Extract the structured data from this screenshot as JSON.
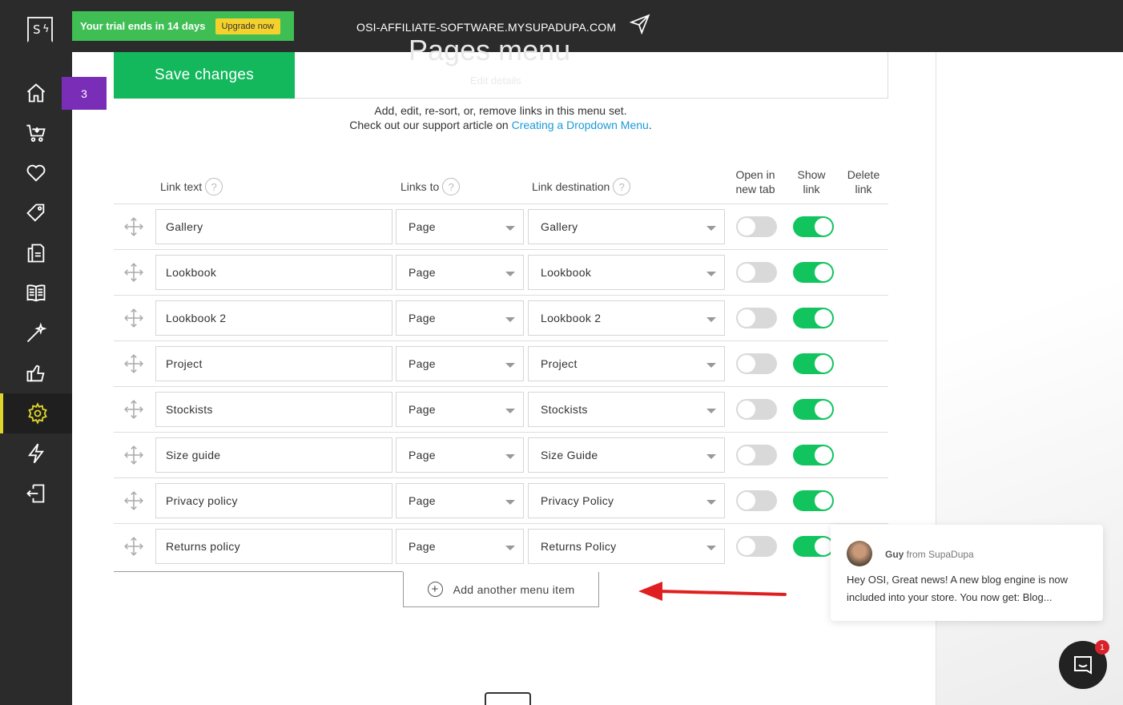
{
  "topbar": {
    "trial_text": "Your trial ends in 14 days",
    "upgrade_label": "Upgrade now",
    "site_url": "OSI-AFFILIATE-SOFTWARE.MYSUPADUPA.COM"
  },
  "sidebar": {
    "logo": "S",
    "badge_count": "3",
    "items": [
      {
        "icon": "home-icon"
      },
      {
        "icon": "cart-icon"
      },
      {
        "icon": "heart-icon"
      },
      {
        "icon": "tag-icon"
      },
      {
        "icon": "pages-icon"
      },
      {
        "icon": "book-icon"
      },
      {
        "icon": "magic-wand-icon"
      },
      {
        "icon": "thumbs-up-icon"
      },
      {
        "icon": "gear-icon",
        "active": true
      },
      {
        "icon": "lightning-icon"
      },
      {
        "icon": "logout-icon"
      }
    ]
  },
  "page": {
    "ghost_title": "Pages menu",
    "ghost_subtitle": "Edit details",
    "save_label": "Save changes",
    "desc_line1": "Add, edit, re-sort, or, remove links in this menu set.",
    "desc_line2_prefix": "Check out our support article on ",
    "desc_line2_link": "Creating a Dropdown Menu",
    "desc_line2_suffix": "."
  },
  "table": {
    "headers": {
      "link_text": "Link text",
      "links_to": "Links to",
      "link_destination": "Link destination",
      "open_new_tab_1": "Open in",
      "open_new_tab_2": "new tab",
      "show_link_1": "Show",
      "show_link_2": "link",
      "delete_link_1": "Delete",
      "delete_link_2": "link",
      "help": "?"
    },
    "rows": [
      {
        "text": "Gallery",
        "links_to": "Page",
        "destination": "Gallery",
        "new_tab": false,
        "show": true
      },
      {
        "text": "Lookbook",
        "links_to": "Page",
        "destination": "Lookbook",
        "new_tab": false,
        "show": true
      },
      {
        "text": "Lookbook 2",
        "links_to": "Page",
        "destination": "Lookbook 2",
        "new_tab": false,
        "show": true
      },
      {
        "text": "Project",
        "links_to": "Page",
        "destination": "Project",
        "new_tab": false,
        "show": true
      },
      {
        "text": "Stockists",
        "links_to": "Page",
        "destination": "Stockists",
        "new_tab": false,
        "show": true
      },
      {
        "text": "Size guide",
        "links_to": "Page",
        "destination": "Size Guide",
        "new_tab": false,
        "show": true
      },
      {
        "text": "Privacy policy",
        "links_to": "Page",
        "destination": "Privacy Policy",
        "new_tab": false,
        "show": true
      },
      {
        "text": "Returns policy",
        "links_to": "Page",
        "destination": "Returns Policy",
        "new_tab": false,
        "show": true
      }
    ],
    "add_item_label": "Add another menu item",
    "add_item_icon": "+"
  },
  "chat": {
    "sender_name": "Guy",
    "sender_from": " from SupaDupa",
    "message": "Hey OSI, Great news! A new blog engine is now included into your store.  You now get: Blog...",
    "unread_count": "1"
  },
  "colors": {
    "sidebar_bg": "#2b2b2b",
    "trial_green": "#3fbe54",
    "upgrade_yellow": "#f4d12c",
    "save_green": "#12b85b",
    "toggle_on": "#12c45e",
    "badge_purple": "#7a2eb8",
    "link_blue": "#1a9bd7",
    "arrow_red": "#e02020"
  }
}
